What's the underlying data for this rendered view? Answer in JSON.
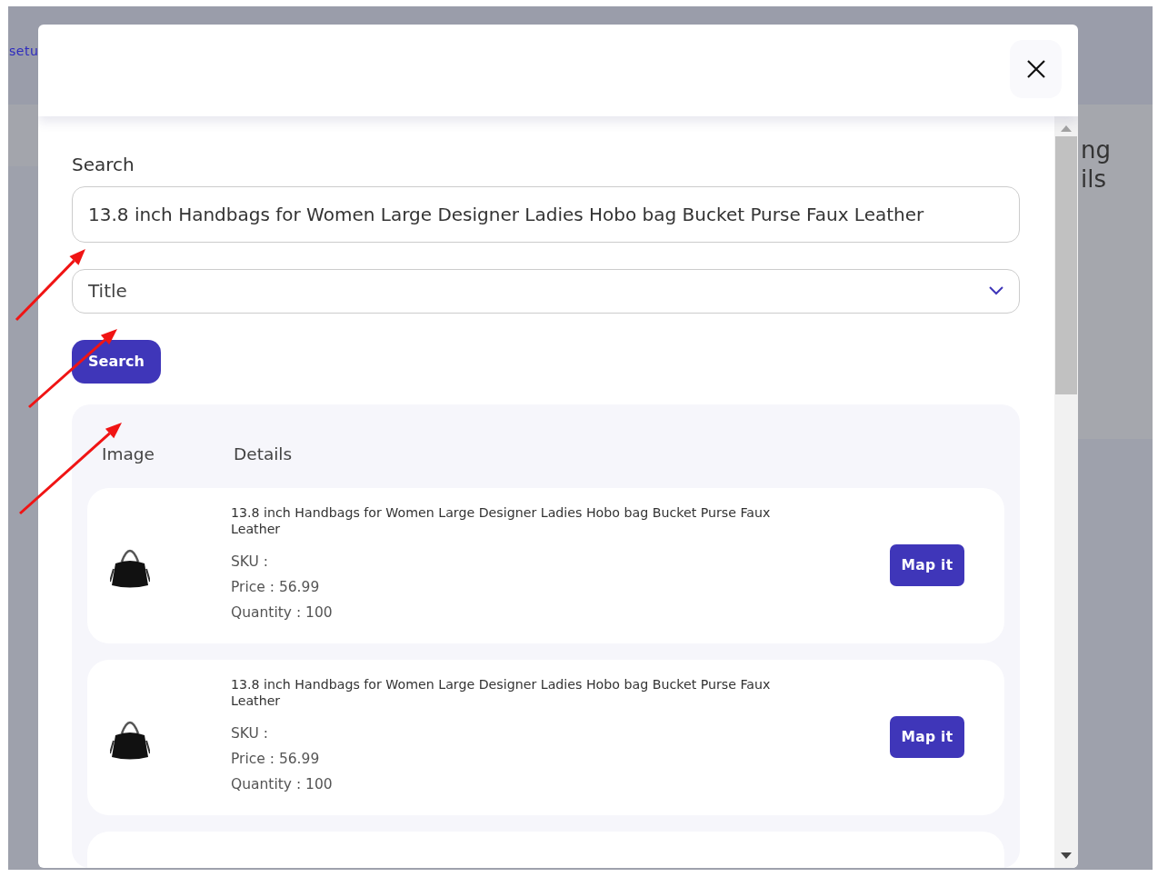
{
  "background": {
    "link_fragment": "setu",
    "heading_lines": [
      "ng",
      "ils"
    ]
  },
  "search_form": {
    "label": "Search",
    "value": "13.8 inch Handbags for Women Large Designer Ladies Hobo bag Bucket Purse Faux Leather",
    "field_select": {
      "value": "Title"
    },
    "button": "Search"
  },
  "results": {
    "columns": [
      "Image",
      "Details"
    ],
    "rows": [
      {
        "title": "13.8 inch Handbags for Women Large Designer Ladies Hobo bag Bucket Purse Faux Leather",
        "sku": "SKU :",
        "price": "Price : 56.99",
        "quantity": "Quantity : 100",
        "button": "Map it"
      },
      {
        "title": "13.8 inch Handbags for Women Large Designer Ladies Hobo bag Bucket Purse Faux Leather",
        "sku": "SKU :",
        "price": "Price : 56.99",
        "quantity": "Quantity : 100",
        "button": "Map it"
      }
    ]
  },
  "annotations": [
    {
      "kind": "arrow"
    },
    {
      "kind": "arrow"
    },
    {
      "kind": "arrow"
    }
  ]
}
